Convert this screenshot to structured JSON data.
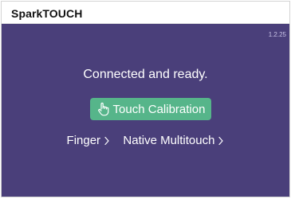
{
  "titlebar": {
    "app_title": "SparkTOUCH"
  },
  "main": {
    "version": "1.2.25",
    "status": "Connected and ready.",
    "calibration_button": {
      "label": "Touch Calibration",
      "icon": "touch-hand-icon"
    },
    "input_mode": {
      "label": "Finger",
      "icon": "chevron-right-icon"
    },
    "touch_mode": {
      "label": "Native Multitouch",
      "icon": "chevron-right-icon"
    }
  },
  "colors": {
    "background": "#4a3f7a",
    "button": "#56b58a",
    "text": "#ffffff"
  }
}
